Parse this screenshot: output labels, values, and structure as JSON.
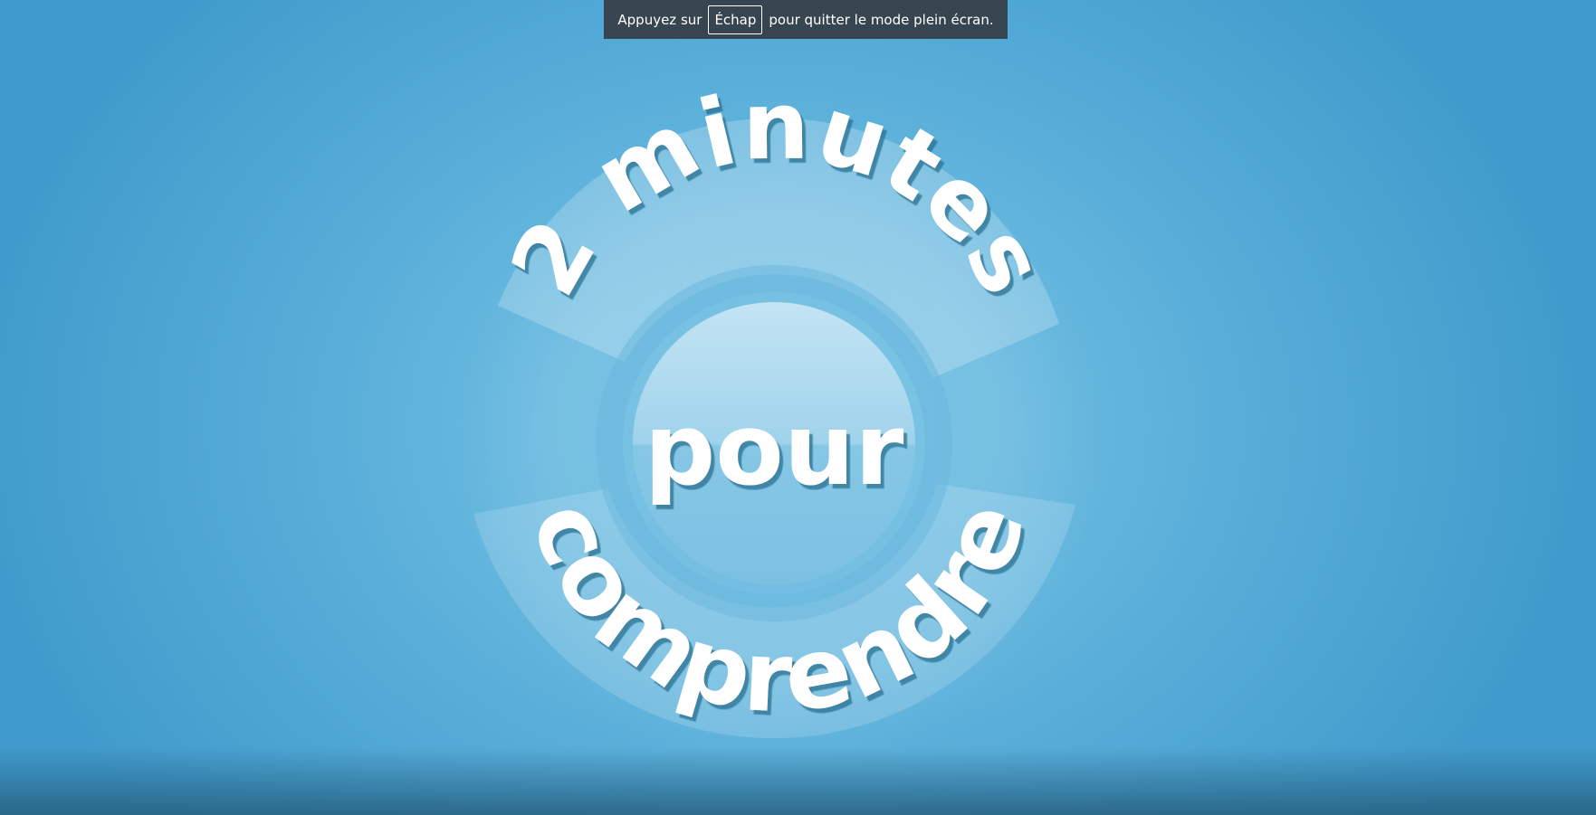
{
  "fullscreen_notice": {
    "before": "Appuyez sur",
    "key": "Échap",
    "after": "pour quitter le mode plein écran."
  },
  "video_frame": {
    "logo": {
      "top_line": "2 minutes",
      "middle_line": "pour",
      "bottom_line": "comprendre"
    }
  },
  "colors": {
    "background": "#5fb3dc",
    "banner": "#36454f",
    "text": "#ffffff"
  }
}
